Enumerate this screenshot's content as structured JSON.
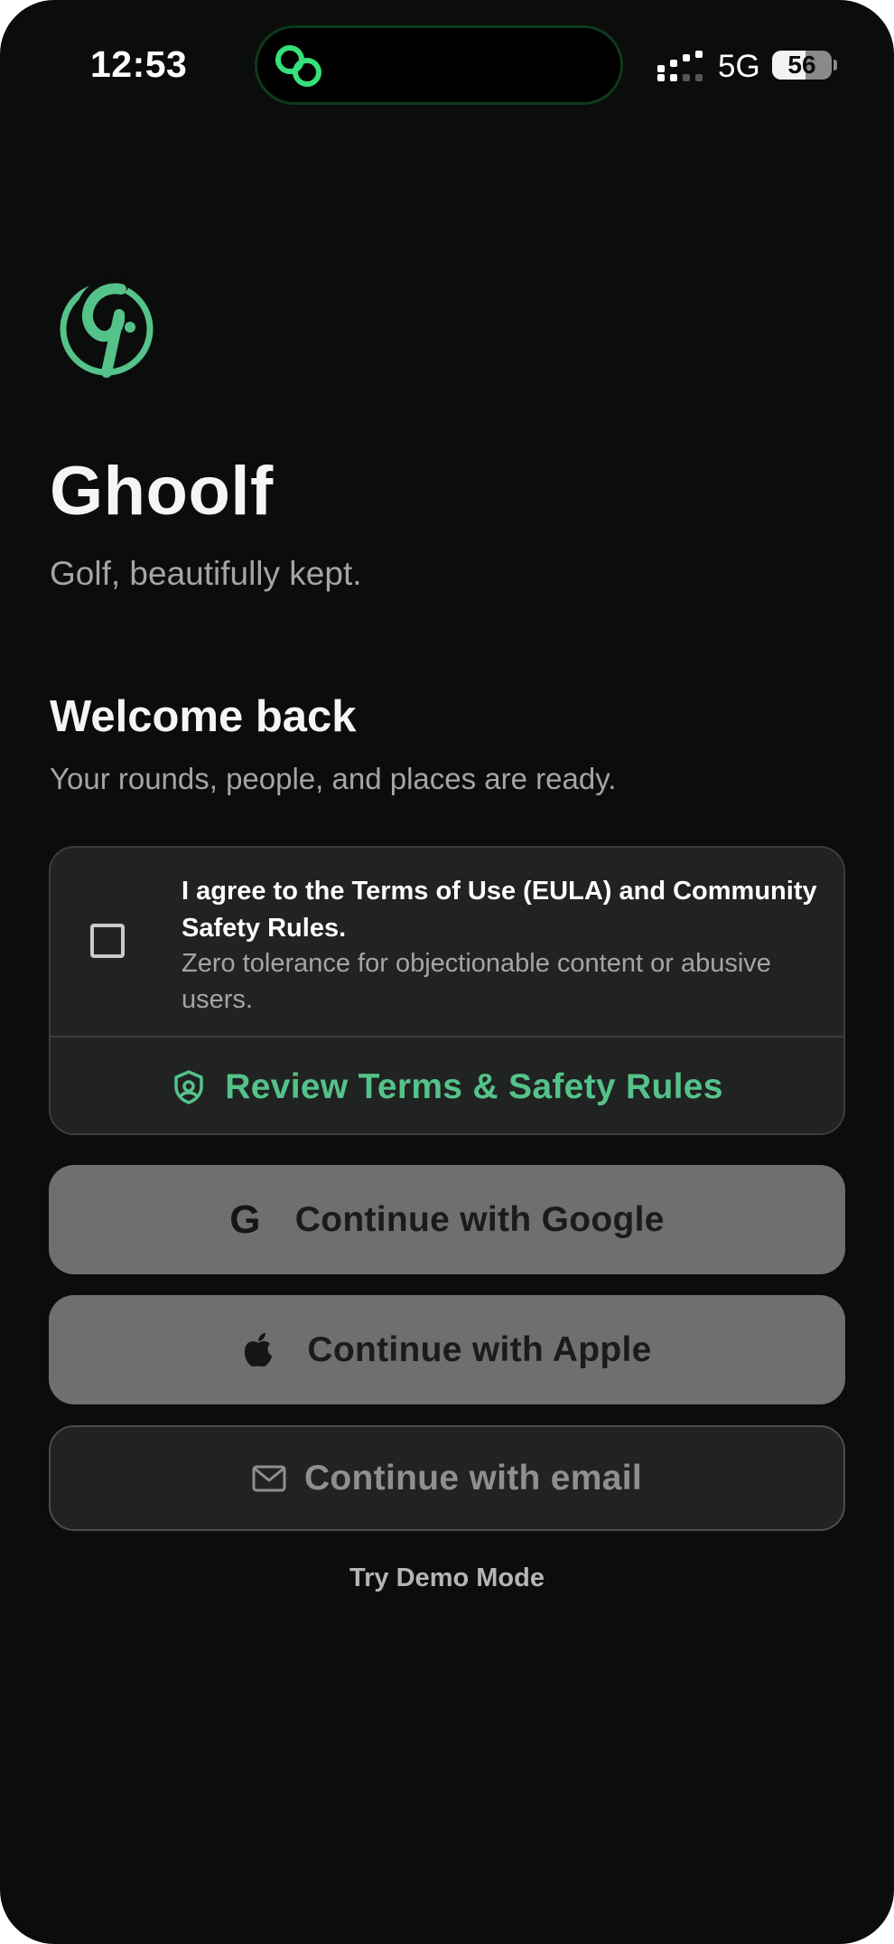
{
  "status_bar": {
    "time": "12:53",
    "network": "5G",
    "battery": "56",
    "battery_level_percent": 56
  },
  "brand": {
    "logo_icon": "ghoolf-logo-icon",
    "name": "Ghoolf",
    "tagline": "Golf, beautifully kept."
  },
  "welcome": {
    "title": "Welcome back",
    "subtitle": "Your rounds, people, and places are ready."
  },
  "terms": {
    "checked": false,
    "agree_text": "I agree to the Terms of Use (EULA) and Community Safety Rules.",
    "tolerance_text": "Zero tolerance for objectionable content or abusive users.",
    "review_label": "Review Terms & Safety Rules"
  },
  "auth": {
    "google_label": "Continue with Google",
    "google_icon_glyph": "G",
    "apple_label": "Continue with Apple",
    "email_label": "Continue with email"
  },
  "demo_label": "Try Demo Mode",
  "colors": {
    "background": "#0b0d0c",
    "accent": "#55c28a",
    "card": "#202321",
    "button_disabled": "#6f6f6f"
  }
}
